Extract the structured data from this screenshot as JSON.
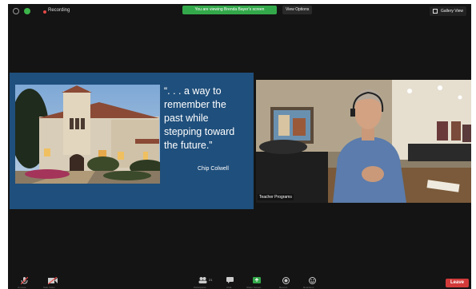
{
  "topbar": {
    "recording_label": "Recording",
    "banner_text": "You are viewing Brenda Bayer's screen",
    "view_options_label": "View Options",
    "gallery_label": "Gallery View"
  },
  "slide": {
    "quote": "“. . . a way to\nremember the\npast while\nstepping toward\nthe future.”",
    "attribution": "Chip Colwell"
  },
  "video": {
    "participant_name": "Teacher Programs"
  },
  "bottombar": {
    "mute_label": "Unmute",
    "video_label": "Start Video",
    "participants_label": "Participants",
    "participants_count": "21",
    "chat_label": "Chat",
    "share_label": "Share Screen",
    "record_label": "Record",
    "reactions_label": "Reactions",
    "leave_label": "Leave"
  },
  "colors": {
    "slide_bg": "#1f4f7c",
    "banner": "#33a84a",
    "leave": "#d23a3a"
  }
}
